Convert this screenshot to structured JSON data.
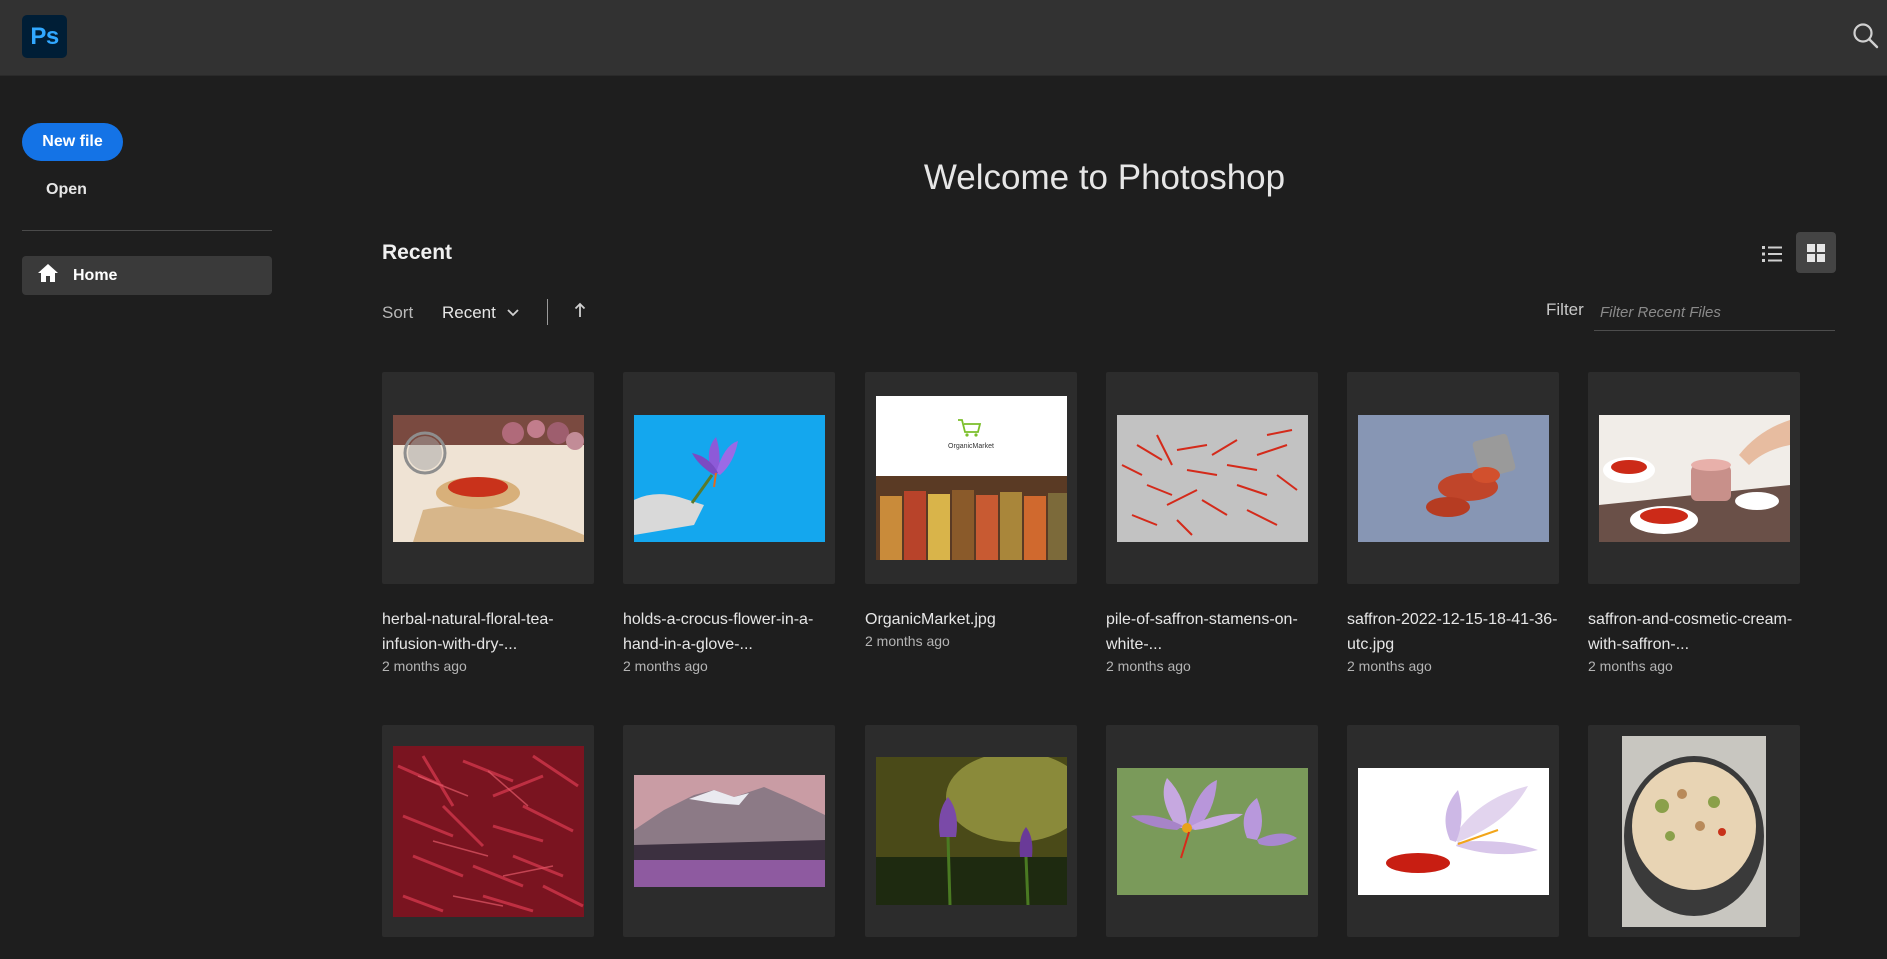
{
  "app": {
    "logo_text": "Ps",
    "search_icon": "search-icon"
  },
  "sidebar": {
    "new_file_label": "New file",
    "open_label": "Open",
    "items": [
      {
        "label": "Home",
        "icon": "home-icon"
      }
    ]
  },
  "main": {
    "welcome_text": "Welcome to Photoshop",
    "recent_title": "Recent",
    "sort_label": "Sort",
    "sort_value": "Recent",
    "filter_label": "Filter",
    "filter_placeholder": "Filter Recent Files",
    "files": [
      {
        "name": "herbal-natural-floral-tea-infusion-with-dry-...",
        "date": "2 months ago"
      },
      {
        "name": "holds-a-crocus-flower-in-a-hand-in-a-glove-...",
        "date": "2 months ago"
      },
      {
        "name": "OrganicMarket.jpg",
        "date": "2 months ago",
        "logo_text": "OrganicMarket"
      },
      {
        "name": "pile-of-saffron-stamens-on-white-...",
        "date": "2 months ago"
      },
      {
        "name": "saffron-2022-12-15-18-41-36-utc.jpg",
        "date": "2 months ago"
      },
      {
        "name": "saffron-and-cosmetic-cream-with-saffron-...",
        "date": "2 months ago"
      },
      {
        "name": "",
        "date": ""
      },
      {
        "name": "",
        "date": ""
      },
      {
        "name": "",
        "date": ""
      },
      {
        "name": "",
        "date": ""
      },
      {
        "name": "",
        "date": ""
      },
      {
        "name": "",
        "date": ""
      }
    ]
  },
  "colors": {
    "accent": "#1473e6",
    "background": "#1e1e1e",
    "topbar": "#323232",
    "logo_bg": "#001e36",
    "logo_fg": "#31a8ff"
  }
}
